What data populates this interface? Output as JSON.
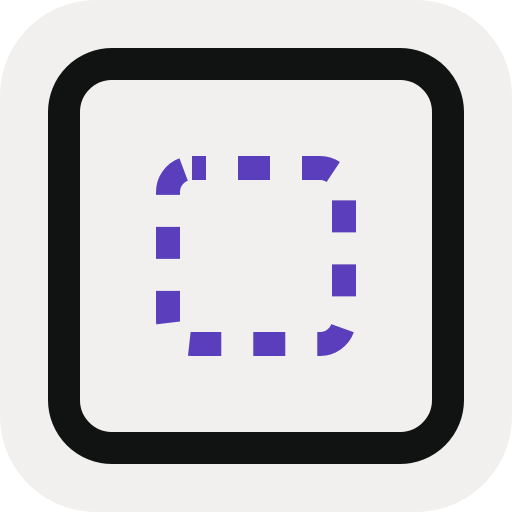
{
  "icon": {
    "name": "selection-frame-icon",
    "tile_color": "#F1F0EF",
    "frame_color": "#111312",
    "frame_fill": "#F1F0EF",
    "selection_color": "#5B3EBB"
  }
}
